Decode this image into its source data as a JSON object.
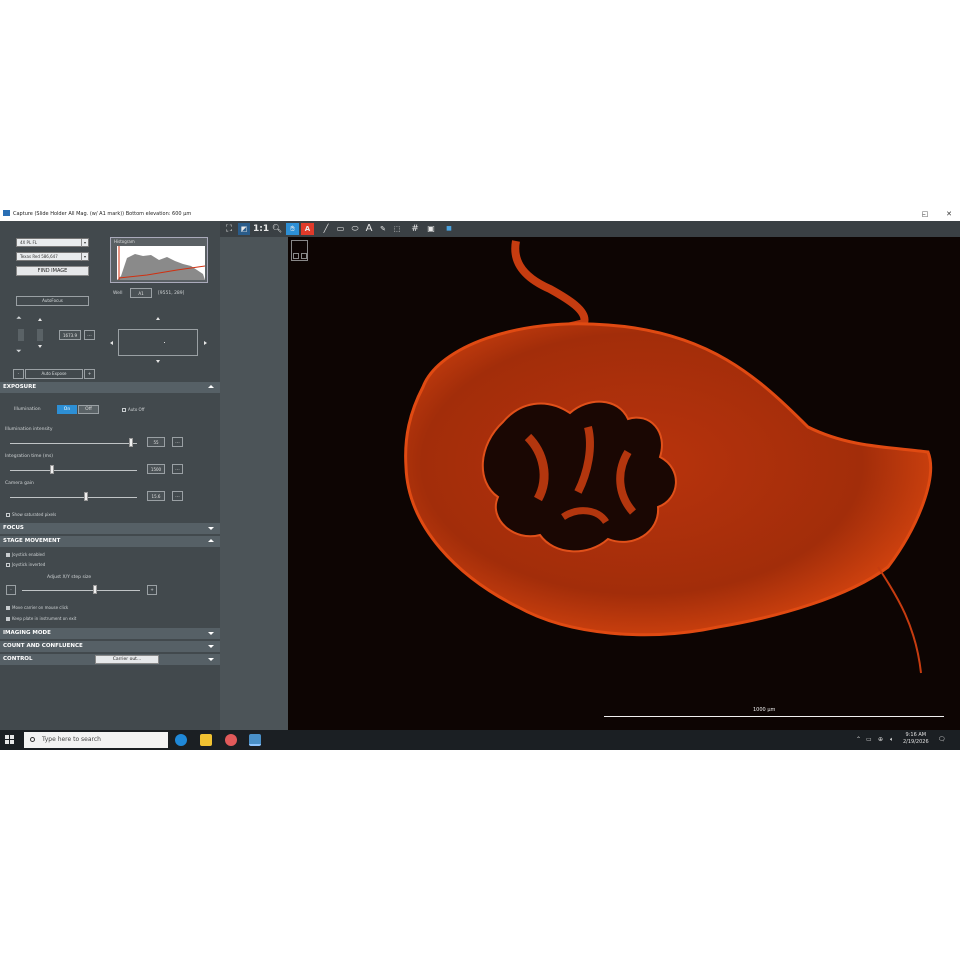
{
  "window": {
    "title": "Capture (Slide Holder All Mag. (w/ A1 mark)) Bottom elevation: 600 µm"
  },
  "side_panel": {
    "objective_select": "4X PL FL",
    "channel_select": "Texas Red 586,647",
    "find_image_label": "FIND IMAGE",
    "histogram_label": "Histogram",
    "autofocus_label": "AutoFocus",
    "well_label": "Well",
    "well_value": "A1",
    "well_coords": "[9551, 289]",
    "focus_value": "1673.9",
    "auto_expose_label": "Auto Expose",
    "auto_expose_minus": "-",
    "auto_expose_plus": "+",
    "dots": "..."
  },
  "exposure": {
    "header": "EXPOSURE",
    "illumination_label": "Illumination",
    "on_label": "On",
    "off_label": "Off",
    "auto_off_label": "Auto Off",
    "intensity_label": "Illumination intensity",
    "intensity_value": "55",
    "intensity_level": 0.95,
    "integration_label": "Integration time (ms)",
    "integration_value": "1500",
    "integration_level": 0.33,
    "gain_label": "Camera gain",
    "gain_value": "15.6",
    "gain_level": 0.6,
    "show_saturated_label": "Show saturated pixels"
  },
  "focus": {
    "header": "FOCUS"
  },
  "stage": {
    "header": "STAGE MOVEMENT",
    "joystick_enabled_label": "Joystick enabled",
    "joystick_inverted_label": "Joystick inverted",
    "step_label": "Adjust X/Y step size",
    "step_minus": "-",
    "step_plus": "+",
    "step_level": 0.62,
    "move_carrier_label": "Move carrier on mouse click",
    "keep_plate_label": "Keep plate in instrument on exit"
  },
  "imaging_mode": {
    "header": "IMAGING MODE"
  },
  "count": {
    "header": "COUNT AND CONFLUENCE"
  },
  "control": {
    "header": "CONTROL",
    "carrier_out_label": "Carrier out..."
  },
  "toolbar": {
    "zoom_label": "1:1",
    "text_tool": "A"
  },
  "viewer": {
    "scale_label": "1000 µm"
  },
  "taskbar": {
    "search_placeholder": "Type here to search",
    "time": "9:16 AM",
    "date": "2/19/2026"
  },
  "colors": {
    "accent": "#2d8fd5",
    "tissue": "#c8380c",
    "background": "#0d0503"
  }
}
